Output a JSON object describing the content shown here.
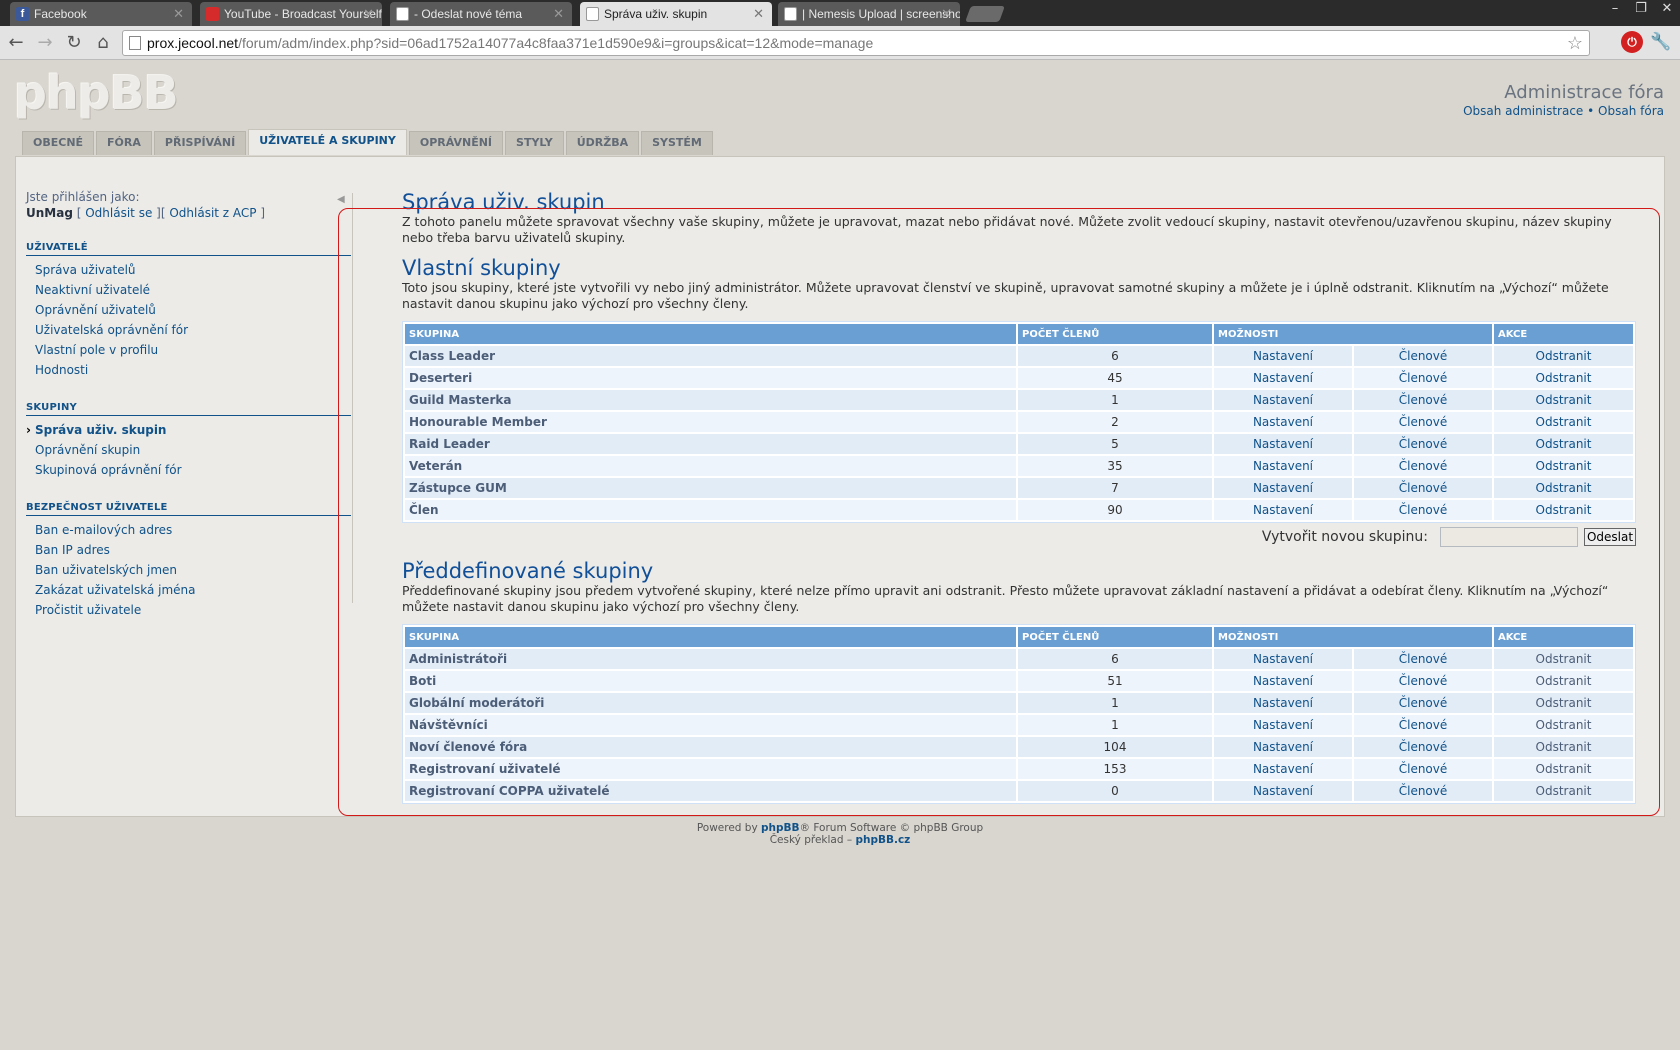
{
  "browser": {
    "tabs": [
      {
        "title": "Facebook",
        "icon": "facebook-icon"
      },
      {
        "title": "YouTube - Broadcast Yourself",
        "icon": "youtube-icon"
      },
      {
        "title": "- Odeslat nové téma",
        "icon": "page-icon"
      },
      {
        "title": "Správa uživ. skupin",
        "icon": "page-icon"
      },
      {
        "title": "| Nemesis Upload | screensho",
        "icon": "page-icon"
      }
    ],
    "url_host": "prox.jecool.net",
    "url_path": "/forum/adm/index.php?sid=06ad1752a14077a4c8faa371e1d590e9&i=groups&icat=12&mode=manage"
  },
  "header": {
    "logo": "phpBB",
    "title": "Administrace fóra",
    "link_admin": "Obsah administrace",
    "separator": "•",
    "link_forum": "Obsah fóra"
  },
  "nav_tabs": [
    "OBECNÉ",
    "FÓRA",
    "PŘISPÍVÁNÍ",
    "UŽIVATELÉ A SKUPINY",
    "OPRÁVNĚNÍ",
    "STYLY",
    "ÚDRŽBA",
    "SYSTÉM"
  ],
  "sidebar": {
    "logged_in_as": "Jste přihlášen jako:",
    "username": "UnMag",
    "logout": "Odhlásit se",
    "logout_acp": "Odhlásit z ACP",
    "sections": [
      {
        "title": "UŽIVATELÉ",
        "items": [
          "Správa uživatelů",
          "Neaktivní uživatelé",
          "Oprávnění uživatelů",
          "Uživatelská oprávnění fór",
          "Vlastní pole v profilu",
          "Hodnosti"
        ]
      },
      {
        "title": "SKUPINY",
        "items": [
          "Správa uživ. skupin",
          "Oprávnění skupin",
          "Skupinová oprávnění fór"
        ]
      },
      {
        "title": "BEZPEČNOST UŽIVATELE",
        "items": [
          "Ban e-mailových adres",
          "Ban IP adres",
          "Ban uživatelských jmen",
          "Zakázat uživatelská jména",
          "Pročistit uživatele"
        ]
      }
    ]
  },
  "main": {
    "title": "Správa uživ. skupin",
    "intro": "Z tohoto panelu můžete spravovat všechny vaše skupiny, můžete je upravovat, mazat nebo přidávat nové. Můžete zvolit vedoucí skupiny, nastavit otevřenou/uzavřenou skupinu, název skupiny nebo třeba barvu uživatelů skupiny.",
    "custom_title": "Vlastní skupiny",
    "custom_desc": "Toto jsou skupiny, které jste vytvořili vy nebo jiný administrátor. Můžete upravovat členství ve skupině, upravovat samotné skupiny a můžete je i úplně odstranit. Kliknutím na „Výchozí“ můžete nastavit danou skupinu jako výchozí pro všechny členy.",
    "columns": [
      "SKUPINA",
      "POČET ČLENŮ",
      "MOŽNOSTI",
      "AKCE"
    ],
    "link_settings": "Nastavení",
    "link_members": "Členové",
    "link_delete": "Odstranit",
    "custom_groups": [
      {
        "name": "Class Leader",
        "count": "6"
      },
      {
        "name": "Deserteri",
        "count": "45"
      },
      {
        "name": "Guild Masterka",
        "count": "1"
      },
      {
        "name": "Honourable Member",
        "count": "2"
      },
      {
        "name": "Raid Leader",
        "count": "5"
      },
      {
        "name": "Veterán",
        "count": "35"
      },
      {
        "name": "Zástupce GUM",
        "count": "7"
      },
      {
        "name": "Člen",
        "count": "90"
      }
    ],
    "create_label": "Vytvořit novou skupinu:",
    "create_value": "",
    "create_button": "Odeslat",
    "predef_title": "Předdefinované skupiny",
    "predef_desc": "Předdefinované skupiny jsou předem vytvořené skupiny, které nelze přímo upravit ani odstranit. Přesto můžete upravovat základní nastavení a přidávat a odebírat členy. Kliknutím na „Výchozí“ můžete nastavit danou skupinu jako výchozí pro všechny členy.",
    "predef_groups": [
      {
        "name": "Administrátoři",
        "count": "6"
      },
      {
        "name": "Boti",
        "count": "51"
      },
      {
        "name": "Globální moderátoři",
        "count": "1"
      },
      {
        "name": "Návštěvníci",
        "count": "1"
      },
      {
        "name": "Noví členové fóra",
        "count": "104"
      },
      {
        "name": "Registrovaní uživatelé",
        "count": "153"
      },
      {
        "name": "Registrovaní COPPA uživatelé",
        "count": "0"
      }
    ]
  },
  "footer": {
    "powered_pre": "Powered by",
    "powered_link": "phpBB",
    "powered_post": "® Forum Software © phpBB Group",
    "translation_pre": "Český překlad –",
    "translation_link": "phpBB.cz"
  },
  "colors": {
    "accent": "#105289",
    "header_row": "#6a9fd3",
    "annotation": "#d31818"
  }
}
